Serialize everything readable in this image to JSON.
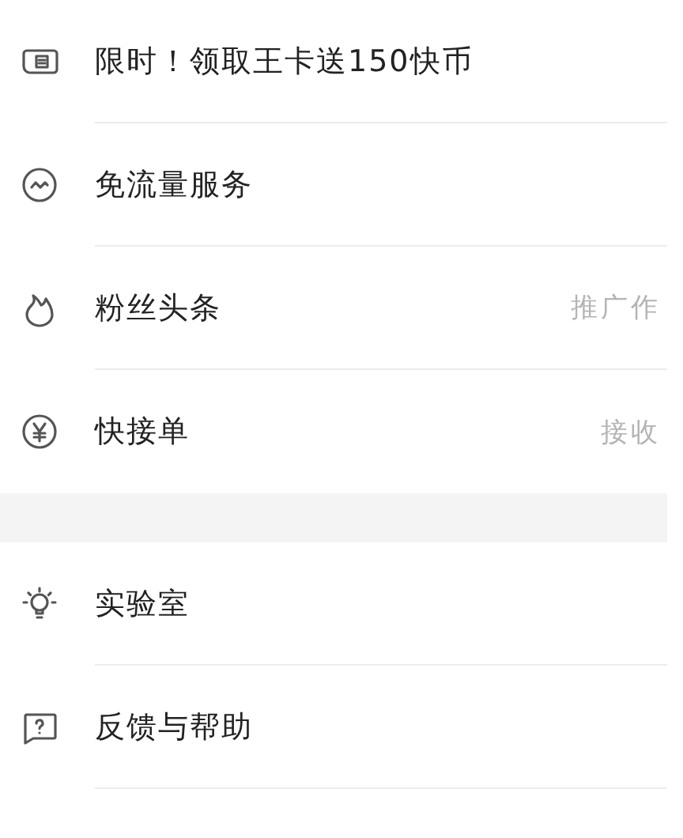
{
  "sections": [
    {
      "items": [
        {
          "label": "限时！领取王卡送150快币"
        },
        {
          "label": "免流量服务"
        },
        {
          "label": "粉丝头条",
          "hint": "推广作"
        },
        {
          "label": "快接单",
          "hint": "接收"
        }
      ]
    },
    {
      "items": [
        {
          "label": "实验室"
        },
        {
          "label": "反馈与帮助"
        }
      ]
    }
  ]
}
